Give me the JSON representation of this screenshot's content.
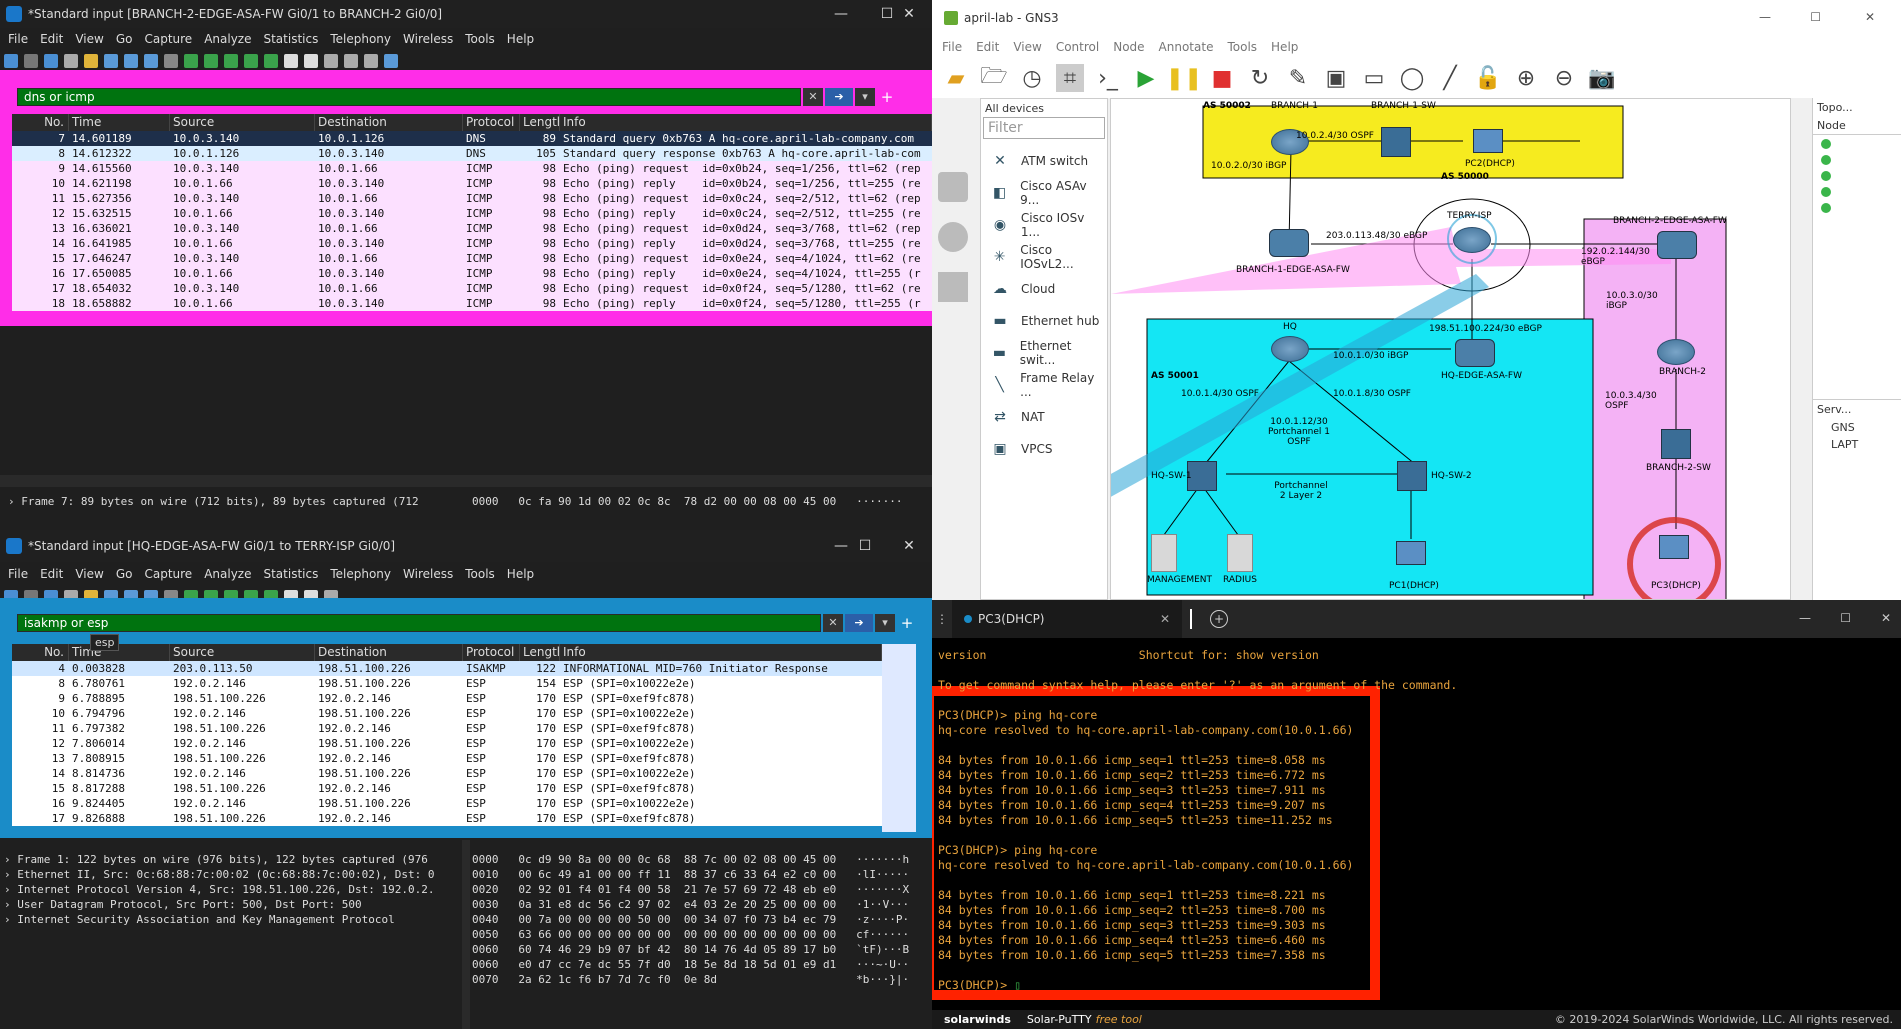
{
  "wireshark1": {
    "title": "*Standard input [BRANCH-2-EDGE-ASA-FW Gi0/1 to BRANCH-2 Gi0/0]",
    "menu": [
      "File",
      "Edit",
      "View",
      "Go",
      "Capture",
      "Analyze",
      "Statistics",
      "Telephony",
      "Wireless",
      "Tools",
      "Help"
    ],
    "filter": "dns or icmp",
    "columns": [
      "No.",
      "Time",
      "Source",
      "Destination",
      "Protocol",
      "Length",
      "Info"
    ],
    "rows": [
      {
        "no": "7",
        "time": "14.601189",
        "src": "10.0.3.140",
        "dst": "10.0.1.126",
        "proto": "DNS",
        "len": "89",
        "info": "Standard query 0xb763 A hq-core.april-lab-company.com"
      },
      {
        "no": "8",
        "time": "14.612322",
        "src": "10.0.1.126",
        "dst": "10.0.3.140",
        "proto": "DNS",
        "len": "105",
        "info": "Standard query response 0xb763 A hq-core.april-lab-com"
      },
      {
        "no": "9",
        "time": "14.615560",
        "src": "10.0.3.140",
        "dst": "10.0.1.66",
        "proto": "ICMP",
        "len": "98",
        "info": "Echo (ping) request  id=0x0b24, seq=1/256, ttl=62 (rep"
      },
      {
        "no": "10",
        "time": "14.621198",
        "src": "10.0.1.66",
        "dst": "10.0.3.140",
        "proto": "ICMP",
        "len": "98",
        "info": "Echo (ping) reply    id=0x0b24, seq=1/256, ttl=255 (re"
      },
      {
        "no": "11",
        "time": "15.627356",
        "src": "10.0.3.140",
        "dst": "10.0.1.66",
        "proto": "ICMP",
        "len": "98",
        "info": "Echo (ping) request  id=0x0c24, seq=2/512, ttl=62 (rep"
      },
      {
        "no": "12",
        "time": "15.632515",
        "src": "10.0.1.66",
        "dst": "10.0.3.140",
        "proto": "ICMP",
        "len": "98",
        "info": "Echo (ping) reply    id=0x0c24, seq=2/512, ttl=255 (re"
      },
      {
        "no": "13",
        "time": "16.636021",
        "src": "10.0.3.140",
        "dst": "10.0.1.66",
        "proto": "ICMP",
        "len": "98",
        "info": "Echo (ping) request  id=0x0d24, seq=3/768, ttl=62 (rep"
      },
      {
        "no": "14",
        "time": "16.641985",
        "src": "10.0.1.66",
        "dst": "10.0.3.140",
        "proto": "ICMP",
        "len": "98",
        "info": "Echo (ping) reply    id=0x0d24, seq=3/768, ttl=255 (re"
      },
      {
        "no": "15",
        "time": "17.646247",
        "src": "10.0.3.140",
        "dst": "10.0.1.66",
        "proto": "ICMP",
        "len": "98",
        "info": "Echo (ping) request  id=0x0e24, seq=4/1024, ttl=62 (re"
      },
      {
        "no": "16",
        "time": "17.650085",
        "src": "10.0.1.66",
        "dst": "10.0.3.140",
        "proto": "ICMP",
        "len": "98",
        "info": "Echo (ping) reply    id=0x0e24, seq=4/1024, ttl=255 (r"
      },
      {
        "no": "17",
        "time": "18.654032",
        "src": "10.0.3.140",
        "dst": "10.0.1.66",
        "proto": "ICMP",
        "len": "98",
        "info": "Echo (ping) request  id=0x0f24, seq=5/1280, ttl=62 (re"
      },
      {
        "no": "18",
        "time": "18.658882",
        "src": "10.0.1.66",
        "dst": "10.0.3.140",
        "proto": "ICMP",
        "len": "98",
        "info": "Echo (ping) reply    id=0x0f24, seq=5/1280, ttl=255 (r"
      }
    ],
    "detail": "Frame 7: 89 bytes on wire (712 bits), 89 bytes captured (712",
    "hex": "0000   0c fa 90 1d 00 02 0c 8c  78 d2 00 00 08 00 45 00   ·······"
  },
  "wireshark2": {
    "title": "*Standard input [HQ-EDGE-ASA-FW Gi0/1 to TERRY-ISP Gi0/0]",
    "menu": [
      "File",
      "Edit",
      "View",
      "Go",
      "Capture",
      "Analyze",
      "Statistics",
      "Telephony",
      "Wireless",
      "Tools",
      "Help"
    ],
    "filter": "isakmp or esp",
    "tooltip": "esp",
    "columns": [
      "No.",
      "Time",
      "Source",
      "Destination",
      "Protocol",
      "Length",
      "Info"
    ],
    "rows": [
      {
        "no": "4",
        "time": "0.003828",
        "src": "203.0.113.50",
        "dst": "198.51.100.226",
        "proto": "ISAKMP",
        "len": "122",
        "info": "INFORMATIONAL MID=760 Initiator Response"
      },
      {
        "no": "8",
        "time": "6.780761",
        "src": "192.0.2.146",
        "dst": "198.51.100.226",
        "proto": "ESP",
        "len": "154",
        "info": "ESP (SPI=0x10022e2e)"
      },
      {
        "no": "9",
        "time": "6.788895",
        "src": "198.51.100.226",
        "dst": "192.0.2.146",
        "proto": "ESP",
        "len": "170",
        "info": "ESP (SPI=0xef9fc878)"
      },
      {
        "no": "10",
        "time": "6.794796",
        "src": "192.0.2.146",
        "dst": "198.51.100.226",
        "proto": "ESP",
        "len": "170",
        "info": "ESP (SPI=0x10022e2e)"
      },
      {
        "no": "11",
        "time": "6.797382",
        "src": "198.51.100.226",
        "dst": "192.0.2.146",
        "proto": "ESP",
        "len": "170",
        "info": "ESP (SPI=0xef9fc878)"
      },
      {
        "no": "12",
        "time": "7.806014",
        "src": "192.0.2.146",
        "dst": "198.51.100.226",
        "proto": "ESP",
        "len": "170",
        "info": "ESP (SPI=0x10022e2e)"
      },
      {
        "no": "13",
        "time": "7.808915",
        "src": "198.51.100.226",
        "dst": "192.0.2.146",
        "proto": "ESP",
        "len": "170",
        "info": "ESP (SPI=0xef9fc878)"
      },
      {
        "no": "14",
        "time": "8.814736",
        "src": "192.0.2.146",
        "dst": "198.51.100.226",
        "proto": "ESP",
        "len": "170",
        "info": "ESP (SPI=0x10022e2e)"
      },
      {
        "no": "15",
        "time": "8.817288",
        "src": "198.51.100.226",
        "dst": "192.0.2.146",
        "proto": "ESP",
        "len": "170",
        "info": "ESP (SPI=0xef9fc878)"
      },
      {
        "no": "16",
        "time": "9.824405",
        "src": "192.0.2.146",
        "dst": "198.51.100.226",
        "proto": "ESP",
        "len": "170",
        "info": "ESP (SPI=0x10022e2e)"
      },
      {
        "no": "17",
        "time": "9.826888",
        "src": "198.51.100.226",
        "dst": "192.0.2.146",
        "proto": "ESP",
        "len": "170",
        "info": "ESP (SPI=0xef9fc878)"
      }
    ],
    "detail": [
      "Frame 1: 122 bytes on wire (976 bits), 122 bytes captured (976",
      "Ethernet II, Src: 0c:68:88:7c:00:02 (0c:68:88:7c:00:02), Dst: 0",
      "Internet Protocol Version 4, Src: 198.51.100.226, Dst: 192.0.2.",
      "User Datagram Protocol, Src Port: 500, Dst Port: 500",
      "Internet Security Association and Key Management Protocol"
    ],
    "hex": [
      "0000   0c d9 90 8a 00 00 0c 68  88 7c 00 02 08 00 45 00   ·······h",
      "0010   00 6c 49 a1 00 00 ff 11  88 37 c6 33 64 e2 c0 00   ·lI·····",
      "0020   02 92 01 f4 01 f4 00 58  21 7e 57 69 72 48 eb e0   ·······X",
      "0030   0a 31 e8 dc 56 c2 97 02  e4 03 2e 20 25 00 00 00   ·1··V···",
      "0040   00 7a 00 00 00 00 50 00  00 34 07 f0 73 b4 ec 79   ·z····P·",
      "0050   63 66 00 00 00 00 00 00  00 00 00 00 00 00 00 00   cf······",
      "0060   60 74 46 29 b9 07 bf 42  80 14 76 4d 05 89 17 b0   `tF)···B",
      "0060   e0 d7 cc 7e dc 55 7f d0  18 5e 8d 18 5d 01 e9 d1   ···~·U··",
      "0070   2a 62 1c f6 b7 7d 7c f0  0e 8d                     *b···}|·"
    ]
  },
  "gns3": {
    "title": "april-lab - GNS3",
    "menu": [
      "File",
      "Edit",
      "View",
      "Control",
      "Node",
      "Annotate",
      "Tools",
      "Help"
    ],
    "devices_header": "All devices",
    "filter_placeholder": "Filter",
    "devices": [
      "ATM switch",
      "Cisco ASAv 9...",
      "Cisco IOSv 1...",
      "Cisco IOSvL2...",
      "Cloud",
      "Ethernet hub",
      "Ethernet swit...",
      "Frame Relay ...",
      "NAT",
      "VPCS"
    ],
    "topology_header": "Topo...",
    "topology_col": "Node",
    "servers_header": "Serv...",
    "servers": [
      "GNS",
      "LAPT"
    ],
    "topology": {
      "as50002": "AS 50002",
      "as50000": "AS 50000",
      "as50001": "AS 50001",
      "branch1": "BRANCH-1",
      "branch1sw": "BRANCH-1-SW",
      "pc2": "PC2(DHCP)",
      "branch1asa": "BRANCH-1-EDGE-ASA-FW",
      "terry": "TERRY-ISP",
      "branch2asa": "BRANCH-2-EDGE-ASA-FW",
      "branch2": "BRANCH-2",
      "branch2sw": "BRANCH-2-SW",
      "pc3": "PC3(DHCP)",
      "hq": "HQ",
      "hqasa": "HQ-EDGE-ASA-FW",
      "hqsw1": "HQ-SW-1",
      "hqsw2": "HQ-SW-2",
      "mgmt": "MANAGEMENT",
      "radius": "RADIUS",
      "pc1": "PC1(DHCP)",
      "l1": "10.0.2.4/30 OSPF",
      "l2": "10.0.2.0/30 iBGP",
      "l3": "203.0.113.48/30 eBGP",
      "l4": "192.0.2.144/30 eBGP",
      "l5": "10.0.3.0/30 iBGP",
      "l6": "198.51.100.224/30 eBGP",
      "l7": "10.0.1.0/30 iBGP",
      "l8": "10.0.1.4/30 OSPF",
      "l9": "10.0.1.8/30 OSPF",
      "l10": "10.0.1.12/30 Portchannel 1 OSPF",
      "l11": "Portchannel 2 Layer 2",
      "l12": "10.0.3.4/30 OSPF"
    }
  },
  "putty": {
    "tab": "PC3(DHCP)",
    "footer_brand": "solarwinds",
    "footer_tool": "Solar-PuTTY",
    "footer_free": "free tool",
    "footer_copy": "© 2019-2024 SolarWinds Worldwide, LLC. All rights reserved.",
    "lines": [
      "version                      Shortcut for: show version",
      "",
      "To get command syntax help, please enter '?' as an argument of the command.",
      "",
      "PC3(DHCP)> ping hq-core",
      "hq-core resolved to hq-core.april-lab-company.com(10.0.1.66)",
      "",
      "84 bytes from 10.0.1.66 icmp_seq=1 ttl=253 time=8.058 ms",
      "84 bytes from 10.0.1.66 icmp_seq=2 ttl=253 time=6.772 ms",
      "84 bytes from 10.0.1.66 icmp_seq=3 ttl=253 time=7.911 ms",
      "84 bytes from 10.0.1.66 icmp_seq=4 ttl=253 time=9.207 ms",
      "84 bytes from 10.0.1.66 icmp_seq=5 ttl=253 time=11.252 ms",
      "",
      "PC3(DHCP)> ping hq-core",
      "hq-core resolved to hq-core.april-lab-company.com(10.0.1.66)",
      "",
      "84 bytes from 10.0.1.66 icmp_seq=1 ttl=253 time=8.221 ms",
      "84 bytes from 10.0.1.66 icmp_seq=2 ttl=253 time=8.700 ms",
      "84 bytes from 10.0.1.66 icmp_seq=3 ttl=253 time=9.303 ms",
      "84 bytes from 10.0.1.66 icmp_seq=4 ttl=253 time=6.460 ms",
      "84 bytes from 10.0.1.66 icmp_seq=5 ttl=253 time=7.358 ms",
      "",
      "PC3(DHCP)> "
    ]
  },
  "colors": {
    "magenta": "#ff2de8",
    "blue_frame": "#1a8cc8",
    "red_frame": "#ff2200",
    "filter_green": "#00730f"
  }
}
